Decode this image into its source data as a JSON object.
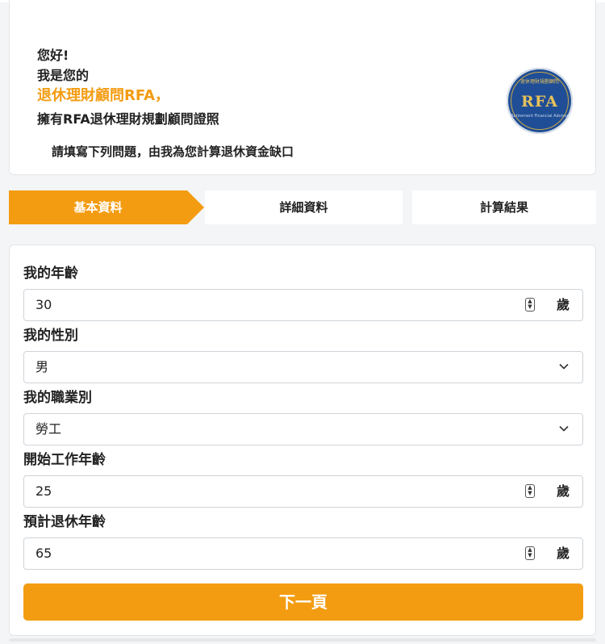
{
  "intro": {
    "greeting": "您好!",
    "line2": "我是您的",
    "highlight": "退休理財顧問RFA，",
    "line4": "擁有RFA退休理財規劃顧問證照",
    "note": "請填寫下列問題，由我為您計算退休資金缺口",
    "badge": {
      "abbr": "RFA",
      "arc_text": "退休理財規劃顧問",
      "sub_text": "Retirement Financial Advisor"
    }
  },
  "steps": [
    {
      "label": "基本資料",
      "active": true
    },
    {
      "label": "詳細資料",
      "active": false
    },
    {
      "label": "計算結果",
      "active": false
    }
  ],
  "form": {
    "age": {
      "label": "我的年齡",
      "value": "30",
      "unit": "歲"
    },
    "gender": {
      "label": "我的性別",
      "value": "男"
    },
    "occupation": {
      "label": "我的職業別",
      "value": "勞工"
    },
    "start_age": {
      "label": "開始工作年齡",
      "value": "25",
      "unit": "歲"
    },
    "retire_age": {
      "label": "預計退休年齡",
      "value": "65",
      "unit": "歲"
    },
    "next_label": "下一頁"
  },
  "icons": {
    "stepper": "stepper-icon",
    "dropdown": "chevron-down-icon"
  },
  "colors": {
    "accent": "#f39c12",
    "badge_blue": "#1f4e96",
    "badge_gold": "#e6c15a"
  }
}
